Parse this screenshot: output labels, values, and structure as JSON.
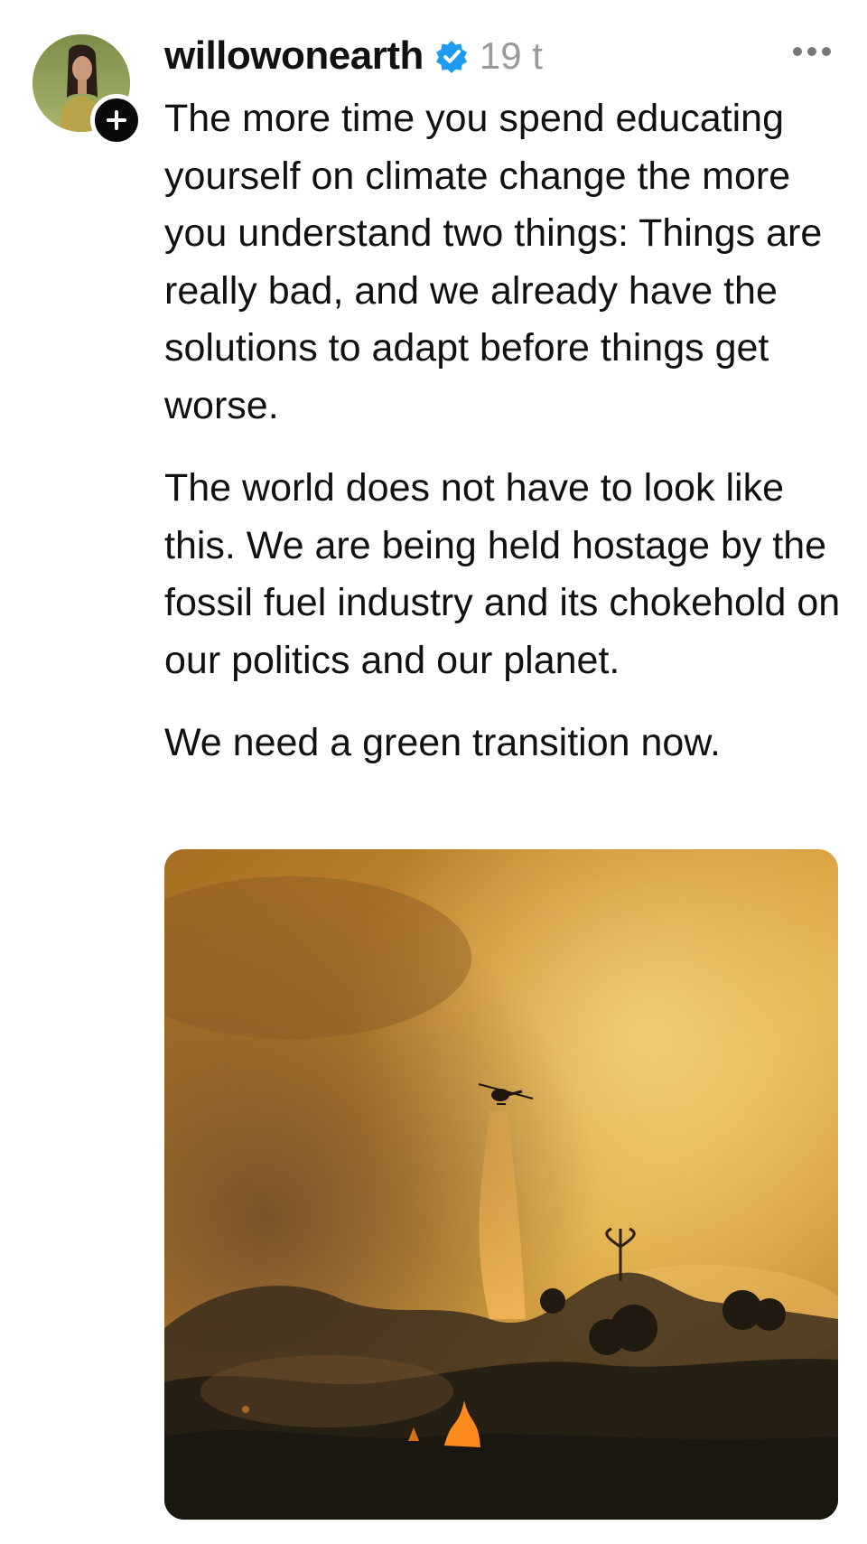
{
  "post": {
    "username": "willowonearth",
    "verified": true,
    "timestamp": "19 t",
    "paragraphs": [
      "The more time you spend educating yourself on climate change the more you understand two things: Things are really bad, and we already have the solutions to adapt before things get worse.",
      "The world does not have to look like this. We are being held hostage by the fossil fuel industry and its chokehold on our politics and our planet.",
      "We need a green transition now."
    ]
  },
  "icons": {
    "verified": "verified-badge-icon",
    "follow": "plus-icon",
    "more": "more-horizontal-icon"
  },
  "colors": {
    "verified_blue": "#1d9bf0",
    "timestamp_gray": "#9a9a9a",
    "text": "#111111",
    "follow_badge": "#0a0a0a"
  }
}
